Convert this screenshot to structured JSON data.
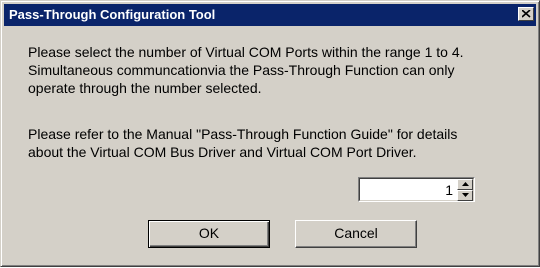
{
  "window": {
    "title": "Pass-Through Configuration Tool"
  },
  "body": {
    "paragraph1": [
      "Please select the number of Virtual COM Ports within the range 1 to 4.",
      "Simultaneous communcationvia the Pass-Through Function can only",
      "operate through the number selected."
    ],
    "paragraph2": [
      "Please refer to the Manual \"Pass-Through Function Guide\" for details",
      "about the Virtual COM Bus Driver and Virtual COM Port Driver."
    ]
  },
  "spinner": {
    "value": "1"
  },
  "buttons": {
    "ok_label": "OK",
    "cancel_label": "Cancel"
  },
  "colors": {
    "titlebar": "#0a246a",
    "face": "#d4d0c8"
  }
}
